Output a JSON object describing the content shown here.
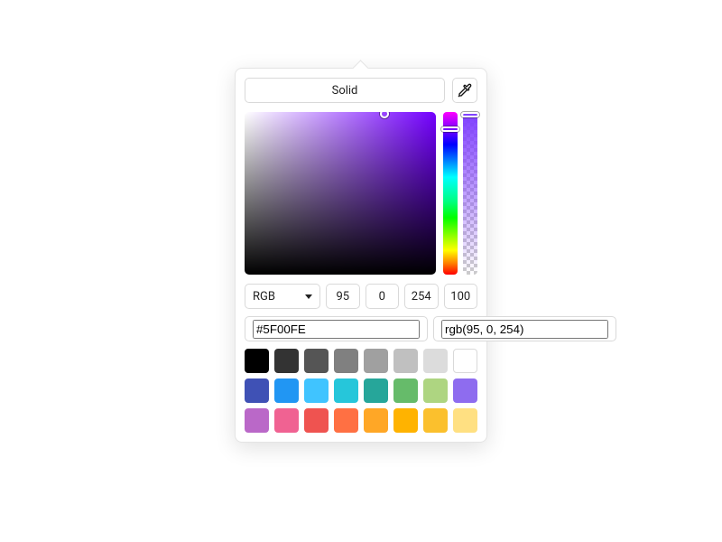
{
  "fill_type": {
    "label": "Solid"
  },
  "model": {
    "selected": "RGB",
    "r": "95",
    "g": "0",
    "b": "254",
    "a": "100",
    "hex": "#5F00FE",
    "rgb_text": "rgb(95, 0, 254)"
  },
  "swatches": [
    "#000000",
    "#333333",
    "#555555",
    "#808080",
    "#a0a0a0",
    "#c0c0c0",
    "#dcdcdc",
    "#ffffff",
    "#3f51b5",
    "#2196f3",
    "#40c4ff",
    "#26c6da",
    "#26a69a",
    "#66bb6a",
    "#aed581",
    "#8e6cef",
    "#ba68c8",
    "#f06292",
    "#ef5350",
    "#ff7043",
    "#ffa726",
    "#ffb300",
    "#fbc02d",
    "#ffe082"
  ]
}
